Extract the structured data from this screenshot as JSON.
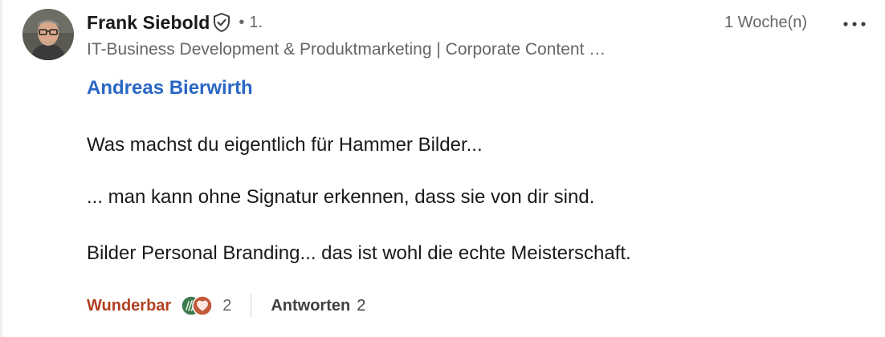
{
  "comment": {
    "author": {
      "name": "Frank Siebold",
      "verified_icon": "shield-check-icon",
      "connection_dot": "•",
      "connection_degree": "1.",
      "headline": "IT-Business Development & Produktmarketing | Corporate Content …"
    },
    "timestamp": "1 Woche(n)",
    "more_options_icon": "ellipsis-icon",
    "mention": "Andreas Bierwirth",
    "lines": [
      "Was machst du eigentlich für Hammer Bilder...",
      "... man kann ohne Signatur erkennen, dass sie von dir sind.",
      "Bilder Personal Branding... das ist wohl die echte Meisterschaft."
    ],
    "actions": {
      "reaction_label": "Wunderbar",
      "reaction_icons": [
        "insightful-icon",
        "love-icon"
      ],
      "reaction_count": "2",
      "reply_label": "Antworten",
      "reply_count": "2"
    }
  },
  "colors": {
    "mention": "#2b67c4",
    "reaction_label": "#b24020",
    "text": "#191919",
    "secondary": "#666666",
    "love_icon_bg": "#c35a3a",
    "insightful_icon_bg": "#3b7a4d"
  }
}
